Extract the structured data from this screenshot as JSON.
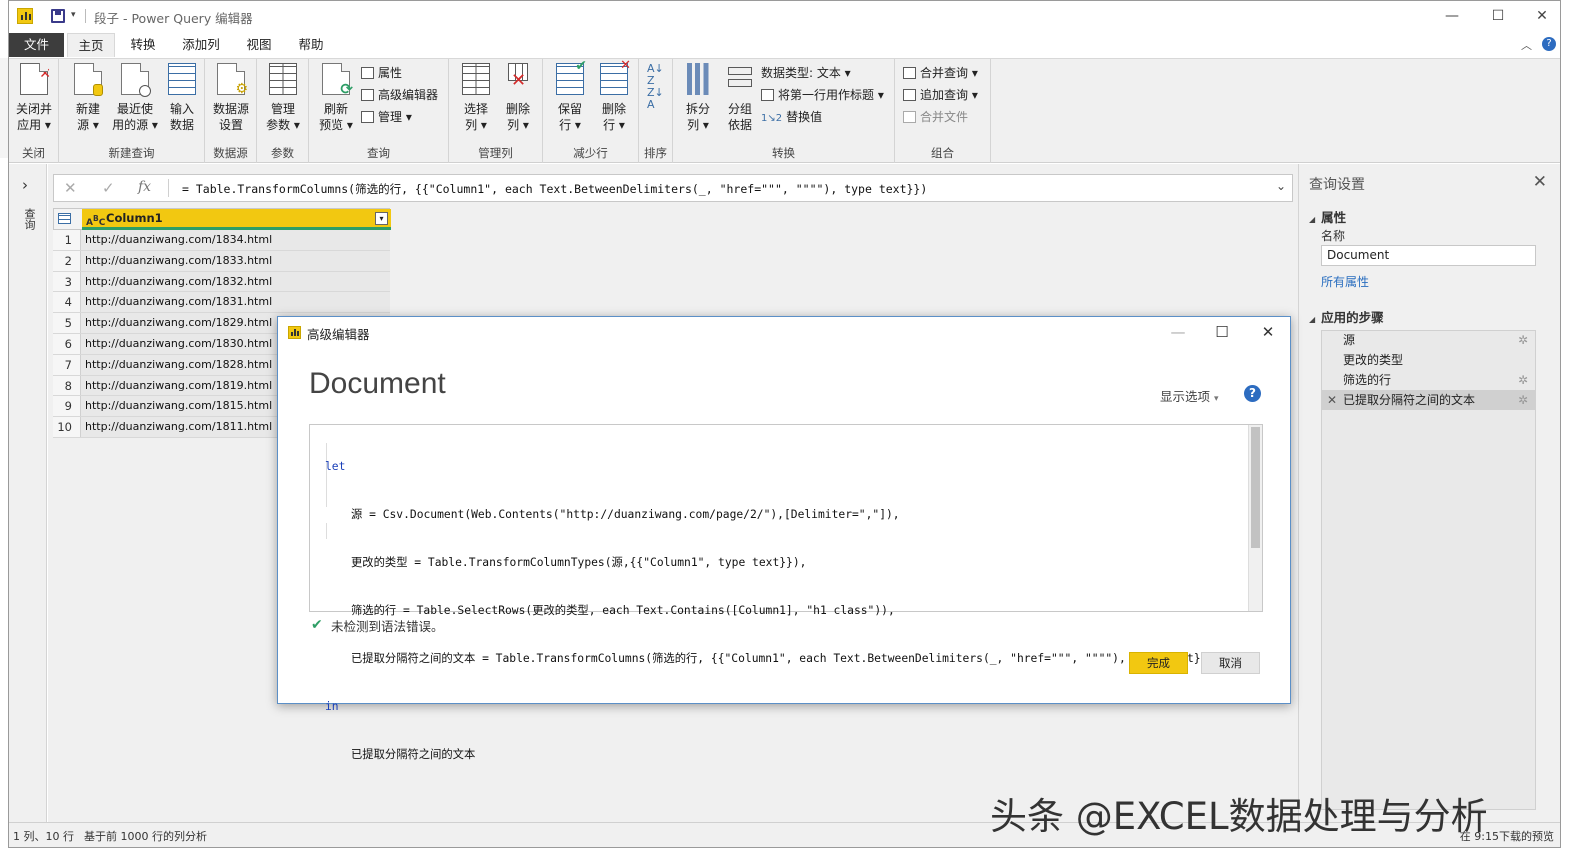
{
  "window": {
    "title": "段子 - Power Query 编辑器"
  },
  "menus": [
    "文件",
    "主页",
    "转换",
    "添加列",
    "视图",
    "帮助"
  ],
  "ribbon": {
    "groups": {
      "close": "关闭",
      "new_query": "新建查询",
      "data_source": "数据源",
      "params": "参数",
      "query": "查询",
      "manage_cols": "管理列",
      "reduce_rows": "减少行",
      "sort": "排序",
      "transform": "转换",
      "combine": "组合"
    },
    "buttons": {
      "close_apply": [
        "关闭并",
        "应用"
      ],
      "new_source": [
        "新建",
        "源"
      ],
      "recent_sources": [
        "最近使",
        "用的源"
      ],
      "enter_data": [
        "输入",
        "数据"
      ],
      "ds_settings": [
        "数据源",
        "设置"
      ],
      "manage_params": [
        "管理",
        "参数"
      ],
      "refresh_preview": [
        "刷新",
        "预览"
      ],
      "properties": "属性",
      "advanced_editor": "高级编辑器",
      "manage": "管理",
      "choose_cols": [
        "选择",
        "列"
      ],
      "remove_cols": [
        "删除",
        "列"
      ],
      "keep_rows": [
        "保留",
        "行"
      ],
      "remove_rows": [
        "删除",
        "行"
      ],
      "split_col": [
        "拆分",
        "列"
      ],
      "group_by": [
        "分组",
        "依据"
      ],
      "data_type": "数据类型: 文本",
      "first_row_header": "将第一行用作标题",
      "replace_values": "替换值",
      "merge_queries": "合并查询",
      "append_queries": "追加查询",
      "combine_files": "合并文件"
    }
  },
  "left_nav": {
    "label": "查询"
  },
  "formula_bar": {
    "text": "= Table.TransformColumns(筛选的行, {{\"Column1\", each Text.BetweenDelimiters(_, \"href=\"\"\", \"\"\"\"), type text}})"
  },
  "grid": {
    "column": "Column1",
    "rows": [
      "http://duanziwang.com/1834.html",
      "http://duanziwang.com/1833.html",
      "http://duanziwang.com/1832.html",
      "http://duanziwang.com/1831.html",
      "http://duanziwang.com/1829.html",
      "http://duanziwang.com/1830.html",
      "http://duanziwang.com/1828.html",
      "http://duanziwang.com/1819.html",
      "http://duanziwang.com/1815.html",
      "http://duanziwang.com/1811.html"
    ]
  },
  "query_settings": {
    "title": "查询设置",
    "properties": "属性",
    "name_label": "名称",
    "name_value": "Document",
    "all_props": "所有属性",
    "applied_steps": "应用的步骤",
    "steps": [
      "源",
      "更改的类型",
      "筛选的行",
      "已提取分隔符之间的文本"
    ]
  },
  "status": {
    "left": "1 列、10 行",
    "mid": "基于前 1000 行的列分析",
    "right": "在 9:15下载的预览"
  },
  "dialog": {
    "title": "高级编辑器",
    "heading": "Document",
    "display_options": "显示选项",
    "code": {
      "l1": "let",
      "l2": "源 = Csv.Document(Web.Contents(\"http://duanziwang.com/page/2/\"),[Delimiter=\",\"]),",
      "l3": "更改的类型 = Table.TransformColumnTypes(源,{{\"Column1\", type text}}),",
      "l4": "筛选的行 = Table.SelectRows(更改的类型, each Text.Contains([Column1], \"h1 class\")),",
      "l5": "已提取分隔符之间的文本 = Table.TransformColumns(筛选的行, {{\"Column1\", each Text.BetweenDelimiters(_, \"href=\"\"\", \"\"\"\"), type text}})",
      "l6": "in",
      "l7": "已提取分隔符之间的文本"
    },
    "status_msg": "未检测到语法错误。",
    "ok": "完成",
    "cancel": "取消"
  },
  "watermark": "头条 @EXCEL数据处理与分析"
}
